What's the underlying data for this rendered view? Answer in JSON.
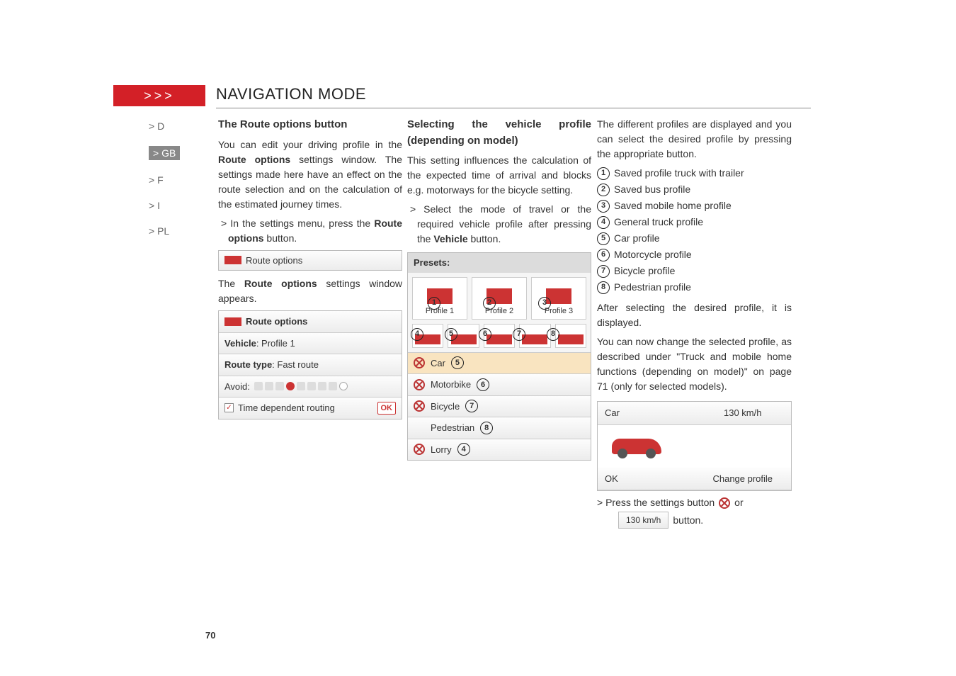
{
  "header": {
    "chevrons": ">>>",
    "title": "NAVIGATION MODE"
  },
  "lang": {
    "d": "> D",
    "gb": "> GB",
    "f": "> F",
    "i": "> I",
    "pl": "> PL"
  },
  "col1": {
    "hdr": "The Route options button",
    "p1a": "You can edit your driving profile in the ",
    "p1b": "Route options",
    "p1c": " settings window. The settings made here have an effect on the route selection and on the calculation of the estimated journey times.",
    "p2a": "> In the settings menu, press the ",
    "p2b": "Route options",
    "p2c": " button.",
    "ui_routeopts": "Route options",
    "p3a": "The ",
    "p3b": "Route options",
    "p3c": " settings window appears.",
    "ui": {
      "route_options": "Route options",
      "vehicle": "Vehicle: Profile 1",
      "route_type": "Route type: Fast route",
      "avoid": "Avoid:",
      "time_dep": "Time dependent routing",
      "ok": "OK"
    }
  },
  "col2": {
    "hdr": "Selecting the vehicle profile (depending on model)",
    "p1": "This setting influences the calculation of the expected time of arrival and blocks e.g. motorways for the bicycle setting.",
    "p2a": "> Select the mode of travel or the required vehicle profile after pressing the ",
    "p2b": "Vehicle",
    "p2c": " button.",
    "presets": "Presets:",
    "profile1": "Profile 1",
    "profile2": "Profile 2",
    "profile3": "Profile 3",
    "car": "Car",
    "motorbike": "Motorbike",
    "bicycle": "Bicycle",
    "pedestrian": "Pedestrian",
    "lorry": "Lorry"
  },
  "col3": {
    "p1": "The different profiles are displayed and you can select the desired profile by pressing the appropriate button.",
    "li1": "Saved profile truck with trailer",
    "li2": "Saved bus profile",
    "li3": "Saved mobile home profile",
    "li4": "General truck profile",
    "li5": "Car profile",
    "li6": "Motorcycle profile",
    "li7": "Bicycle profile",
    "li8": "Pedestrian profile",
    "p2": "After selecting the desired profile, it is displayed.",
    "p3": "You can now change the selected profile, as described under \"Truck and mobile home functions (depending on model)\" on page 71 (only for selected models).",
    "car": "Car",
    "speed": "130 km/h",
    "ok": "OK",
    "change": "Change profile",
    "press1": "> Press the settings button",
    "press2": "or",
    "mini_speed": "130 km/h",
    "press3": "button."
  },
  "page": "70"
}
